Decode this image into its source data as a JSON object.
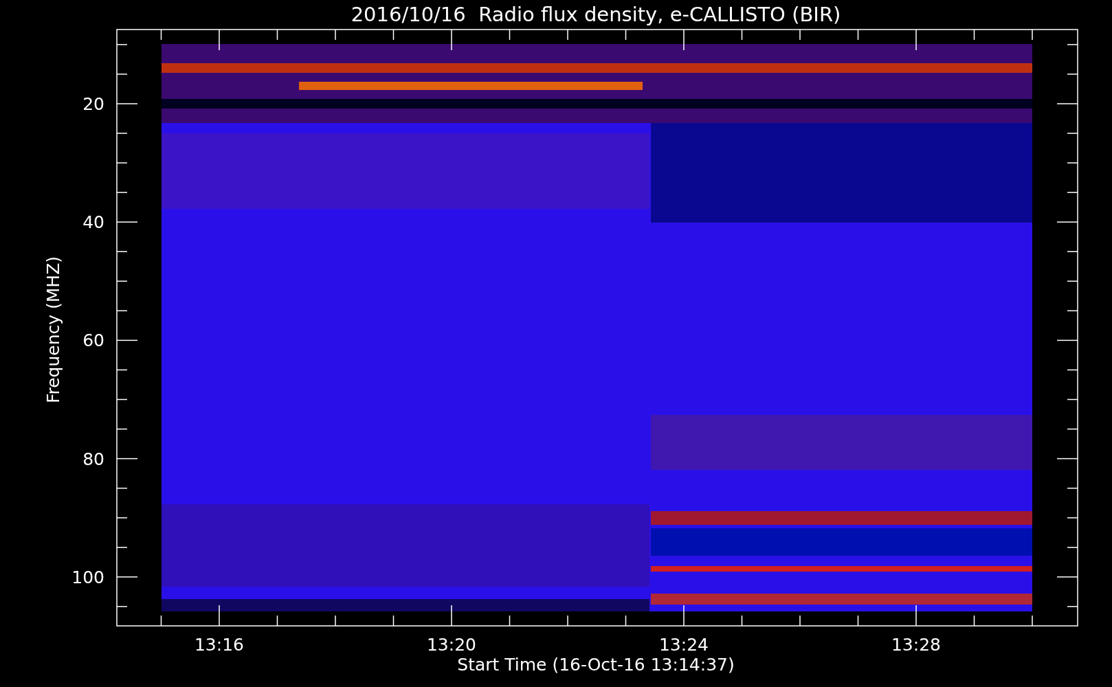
{
  "plot": {
    "title": "2016/10/16  Radio flux density, e-CALLISTO (BIR)",
    "ylabel": "Frequency (MHZ)",
    "xlabel": "Start Time (16-Oct-16 13:14:37)",
    "y_tick_labels": [
      "20",
      "40",
      "60",
      "80",
      "100"
    ],
    "x_tick_labels": [
      "13:16",
      "13:20",
      "13:24",
      "13:28"
    ]
  }
}
